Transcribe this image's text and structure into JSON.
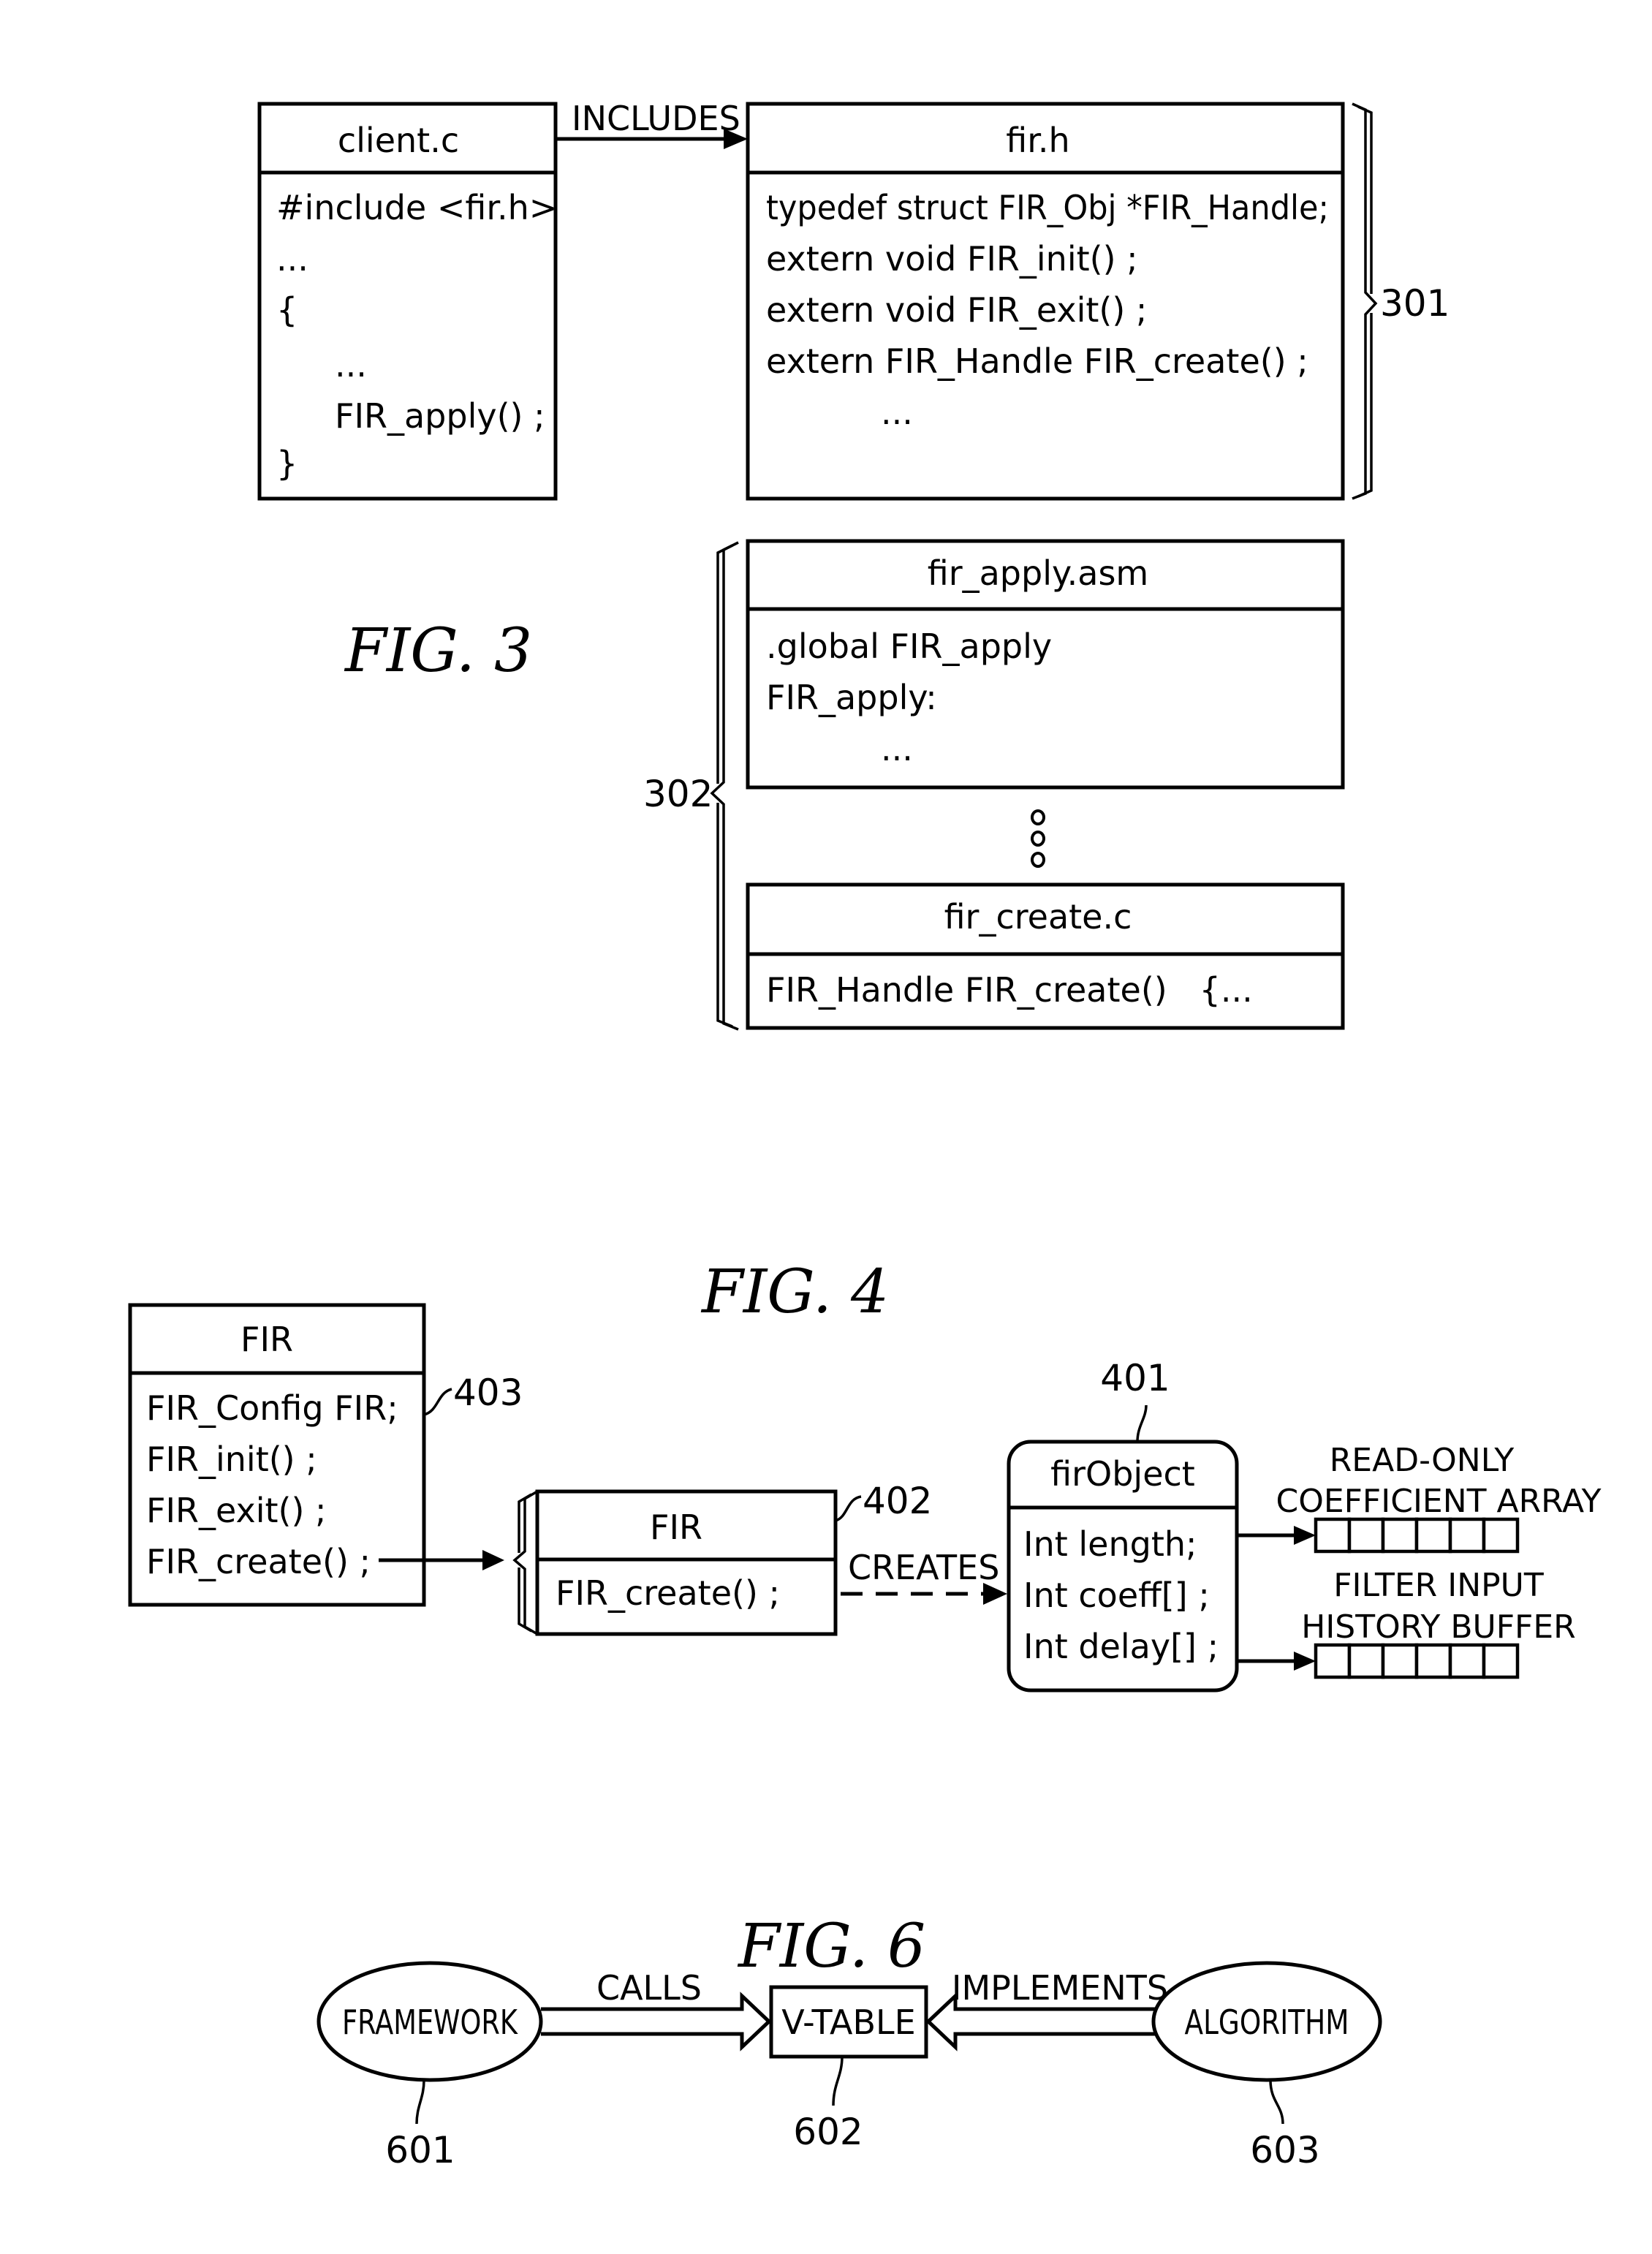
{
  "fig3": {
    "caption": "FIG. 3",
    "client_box": {
      "title": "client.c",
      "lines": [
        "#include <fir.h>",
        "...",
        "{",
        "...",
        "FIR_apply() ;",
        "}"
      ]
    },
    "includes_label": "INCLUDES",
    "header_box": {
      "title": "fir.h",
      "lines": [
        "typedef struct FIR_Obj *FIR_Handle;",
        "extern void FIR_init() ;",
        "extern void FIR_exit() ;",
        "extern FIR_Handle FIR_create() ;",
        "..."
      ]
    },
    "ref_301": "301",
    "asm_box": {
      "title": "fir_apply.asm",
      "lines": [
        ".global FIR_apply",
        "FIR_apply:",
        "..."
      ]
    },
    "create_box": {
      "title": "fir_create.c",
      "lines": [
        "FIR_Handle FIR_create()   {..."
      ]
    },
    "ref_302": "302"
  },
  "fig4": {
    "caption": "FIG. 4",
    "config_box": {
      "title": "FIR",
      "lines": [
        "FIR_Config FIR;",
        "FIR_init() ;",
        "FIR_exit() ;",
        "FIR_create() ;"
      ]
    },
    "ref_403": "403",
    "fir_box": {
      "title": "FIR",
      "lines": [
        "FIR_create() ;"
      ]
    },
    "ref_402": "402",
    "creates_label": "CREATES",
    "object_box": {
      "title": "firObject",
      "lines": [
        "Int length;",
        "Int coeff[] ;",
        "Int delay[] ;"
      ]
    },
    "ref_401": "401",
    "coeff_array": {
      "label_line1": "READ-ONLY",
      "label_line2": "COEFFICIENT ARRAY",
      "cells": 6
    },
    "history_buffer": {
      "label_line1": "FILTER INPUT",
      "label_line2": "HISTORY BUFFER",
      "cells": 6
    }
  },
  "fig6": {
    "caption": "FIG. 6",
    "framework": "FRAMEWORK",
    "vtable": "V-TABLE",
    "algorithm": "ALGORITHM",
    "calls_label": "CALLS",
    "implements_label": "IMPLEMENTS",
    "ref_601": "601",
    "ref_602": "602",
    "ref_603": "603"
  }
}
